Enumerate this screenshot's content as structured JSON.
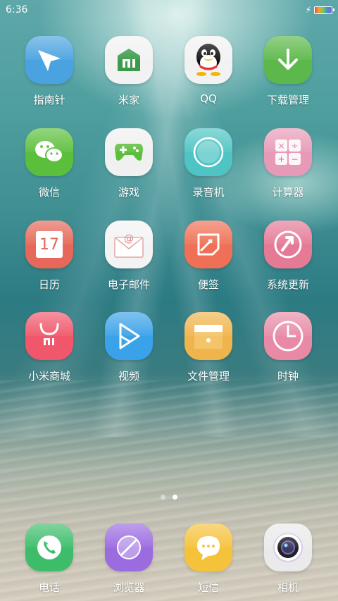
{
  "status_bar": {
    "time": "6:36"
  },
  "apps": [
    {
      "label": "指南针",
      "icon": "compass-icon",
      "color": "#4aa3e0"
    },
    {
      "label": "米家",
      "icon": "mijia-icon",
      "color": "#f2f2f2"
    },
    {
      "label": "QQ",
      "icon": "qq-penguin-icon",
      "color": "#f2f2f2"
    },
    {
      "label": "下载管理",
      "icon": "download-arrow-icon",
      "color": "#5cb84a"
    },
    {
      "label": "微信",
      "icon": "wechat-icon",
      "color": "#5cbf3c"
    },
    {
      "label": "游戏",
      "icon": "gamepad-icon",
      "color": "#f0f0f0"
    },
    {
      "label": "录音机",
      "icon": "recorder-icon",
      "color": "#4fc4c4"
    },
    {
      "label": "计算器",
      "icon": "calculator-icon",
      "color": "#e79ab7"
    },
    {
      "label": "日历",
      "icon": "calendar-icon",
      "color": "#e5685a",
      "calendar_day": "17"
    },
    {
      "label": "电子邮件",
      "icon": "email-envelope-icon",
      "color": "#f3f3f3"
    },
    {
      "label": "便签",
      "icon": "notes-icon",
      "color": "#ef7056"
    },
    {
      "label": "系统更新",
      "icon": "system-update-icon",
      "color": "#e57a96"
    },
    {
      "label": "小米商城",
      "icon": "mi-store-bag-icon",
      "color": "#f0576a"
    },
    {
      "label": "视频",
      "icon": "video-play-icon",
      "color": "#3aa2e8"
    },
    {
      "label": "文件管理",
      "icon": "file-manager-icon",
      "color": "#f0b44c"
    },
    {
      "label": "时钟",
      "icon": "clock-icon",
      "color": "#e88aa6"
    }
  ],
  "page_indicator": {
    "count": 2,
    "active": 2
  },
  "dock": [
    {
      "label": "电话",
      "icon": "phone-icon",
      "color": "#3dbd6a"
    },
    {
      "label": "浏览器",
      "icon": "browser-icon",
      "color": "#9b6be0"
    },
    {
      "label": "短信",
      "icon": "message-bubble-icon",
      "color": "#f5c23c"
    },
    {
      "label": "相机",
      "icon": "camera-lens-icon",
      "color": "#eaeaea"
    }
  ]
}
